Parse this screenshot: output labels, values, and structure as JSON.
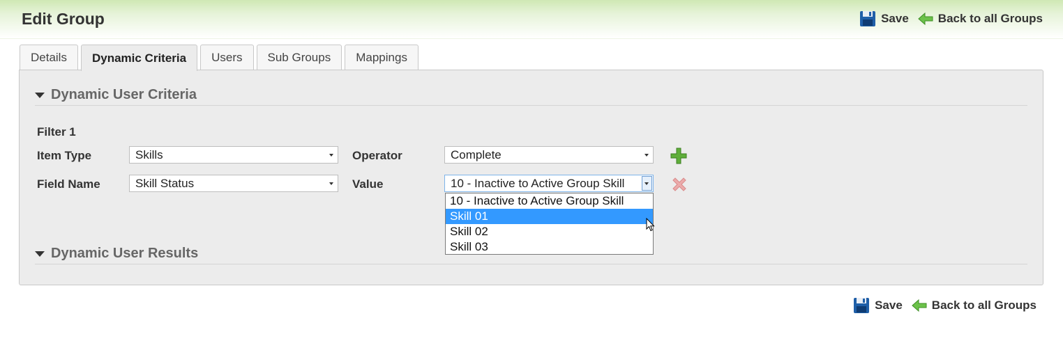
{
  "header": {
    "title": "Edit Group"
  },
  "actions": {
    "save_label": "Save",
    "back_label": "Back to all Groups"
  },
  "tabs": [
    {
      "label": "Details"
    },
    {
      "label": "Dynamic Criteria",
      "active": true
    },
    {
      "label": "Users"
    },
    {
      "label": "Sub Groups"
    },
    {
      "label": "Mappings"
    }
  ],
  "sections": {
    "criteria_title": "Dynamic User Criteria",
    "results_title": "Dynamic User Results"
  },
  "filter": {
    "title": "Filter 1",
    "item_type_label": "Item Type",
    "item_type_value": "Skills",
    "operator_label": "Operator",
    "operator_value": "Complete",
    "field_name_label": "Field Name",
    "field_name_value": "Skill Status",
    "value_label": "Value",
    "value_value": "10 - Inactive to Active Group Skill",
    "value_options": [
      {
        "label": "10 - Inactive to Active Group Skill"
      },
      {
        "label": "Skill 01",
        "highlighted": true
      },
      {
        "label": "Skill 02"
      },
      {
        "label": "Skill 03"
      }
    ]
  },
  "icons": {
    "save": "floppy-disk-icon",
    "back": "green-left-arrow-icon",
    "add": "green-plus-icon",
    "remove": "red-x-icon",
    "collapse": "triangle-down-icon"
  },
  "colors": {
    "header_gradient_top": "#cfe8b4",
    "highlight": "#3399ff",
    "save_icon": "#1f5fa8",
    "arrow_icon": "#6cc24a",
    "add_icon": "#4a9a2a",
    "remove_icon": "#e8a3a3"
  }
}
